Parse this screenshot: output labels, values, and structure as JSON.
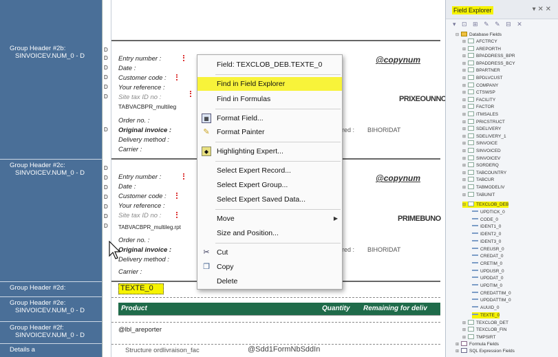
{
  "sections": [
    {
      "line1": "Group Header #2b:",
      "line2": "SINVOICEV.NUM_0 - D"
    },
    {
      "line1": "Group Header #2c:",
      "line2": "SINVOICEV.NUM_0 - D"
    },
    {
      "line1": "Group Header #2d:",
      "line2": ""
    },
    {
      "line1": "Group Header #2e:",
      "line2": "SINVOICEV.NUM_0 - D"
    },
    {
      "line1": "Group Header #2f:",
      "line2": "SINVOICEV.NUM_0 - D"
    },
    {
      "line1": "Details a",
      "line2": ""
    }
  ],
  "ruler_marks": [
    "D",
    "D",
    "D",
    "D",
    "D",
    "D",
    "D",
    "D",
    "D",
    "D",
    "D",
    "D",
    "D",
    "D"
  ],
  "block_b": {
    "labels": [
      "Entry number :",
      "Date :",
      "Customer code :",
      "Your reference :",
      "Site tax ID no :",
      "TABVACBPR_multileg",
      "Order no. :",
      "Original invoice :",
      "Delivery method :",
      "Carrier :"
    ],
    "copynum": "@copynum",
    "blurred": "PRIXEOUNNC",
    "ered": "ered :",
    "bihoridat": "BIHORIDAT"
  },
  "block_c": {
    "labels": [
      "Entry number :",
      "Date :",
      "Customer code :",
      "Your reference :",
      "Site tax ID no :",
      "TABVACBPR_multileg.rpt",
      "Order no. :",
      "Original invoice :",
      "Delivery method :",
      "Carrier :"
    ],
    "copynum": "@copynum",
    "blurred": "PRIMEBUNO",
    "ered": "ered :",
    "bihoridat": "BIHORIDAT"
  },
  "texte_field": "TEXTE_0",
  "green_bar": {
    "product": "Product",
    "quantity": "Quantity",
    "remaining": "Remaining for deliv"
  },
  "lbl_areporter": "@lbl_areporter",
  "details_a": {
    "left": "Structure ordlivraison_fac",
    "mid": "@Sdd1FormNbSddIn"
  },
  "context_menu": {
    "header": "Field: TEXCLOB_DEB.TEXTE_0",
    "find_explorer": "Find in Field Explorer",
    "find_formulas": "Find in Formulas",
    "format_field": "Format Field...",
    "format_painter": "Format Painter",
    "highlighting": "Highlighting Expert...",
    "select_record": "Select Expert Record...",
    "select_group": "Select Expert Group...",
    "select_saved": "Select Expert Saved Data...",
    "move": "Move",
    "size_position": "Size and Position...",
    "cut": "Cut",
    "copy": "Copy",
    "delete": "Delete"
  },
  "field_explorer": {
    "title": "Field Explorer",
    "close": "▾ ✕ ✕",
    "tools": "▾ ⊡ ⊞ ✎ ✎ ⊟ ✕",
    "db_fields": "Database Fields",
    "tables": [
      "AFCTRCY",
      "AREPORTH",
      "BPADDRESS_BPR",
      "BPADDRESS_BCY",
      "BPARTNER",
      "BPDLVCUST",
      "COMPANY",
      "CTSWSP",
      "FACILITY",
      "FACTOR",
      "ITMSALES",
      "PRICSTRUCT",
      "SDELIVERY",
      "SDELIVERY_1",
      "SINVOICE",
      "SINVOICED",
      "SINVOICEV",
      "SORDERQ",
      "TABCOUNTRY",
      "TABCUR",
      "TABMODELIV",
      "TABUNIT"
    ],
    "texclob_deb": "TEXCLOB_DEB",
    "texclob_fields": [
      "UPDTICK_0",
      "CODE_0",
      "IDENT1_0",
      "IDENT2_0",
      "IDENT3_0",
      "CREUSR_0",
      "CREDAT_0",
      "CRETIM_0",
      "UPDUSR_0",
      "UPDDAT_0",
      "UPDTIM_0",
      "CREDATTIM_0",
      "UPDDATTIM_0",
      "AUUID_0"
    ],
    "texte_0": "TEXTE_0",
    "after_tables": [
      "TEXCLOB_DET",
      "TEXCLOB_FIN",
      "TMPSIRT"
    ],
    "formula_fields": "Formula Fields",
    "sql_fields": "SQL Expression Fields"
  },
  "colors": {
    "section_bg": "#4a6f98",
    "highlight": "#f6f300",
    "green_bar": "#1f6b4a"
  }
}
